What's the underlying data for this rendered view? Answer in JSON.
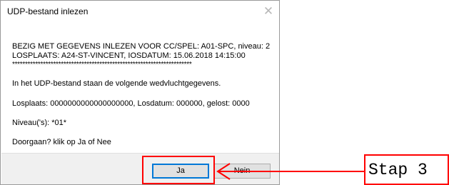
{
  "dialog": {
    "title": "UDP-bestand inlezen",
    "close_glyph": "✕",
    "message_lines": [
      "BEZIG MET GEGEVENS INLEZEN VOOR CC/SPEL: A01-SPC, niveau:  2",
      "LOSPLAATS: A24-ST-VINCENT, IOSDATUM: 15.06.2018 14:15:00",
      "**********************************************************************",
      "In het UDP-bestand staan de volgende wedvluchtgegevens.",
      "Losplaats: 0000000000000000000, Losdatum: 000000, gelost: 0000",
      "Niveau('s): *01*",
      "Doorgaan?   klik op Ja of Nee"
    ],
    "buttons": {
      "yes_label": "Ja",
      "no_label": "Nein"
    }
  },
  "annotation": {
    "label": "Stap 3",
    "color": "#ff0000"
  },
  "icons": {
    "close": "close-icon",
    "arrow": "arrow-left-icon"
  }
}
